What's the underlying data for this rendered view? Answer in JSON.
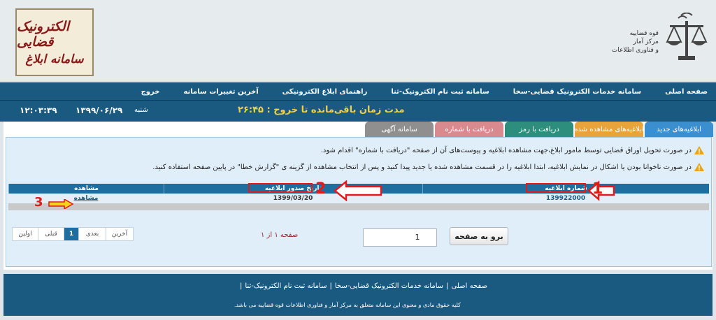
{
  "header": {
    "logo_line1": "الکترونیک قضایی",
    "logo_line2": "سامانه ابلاغ",
    "org_line1": "قوه قضاییه",
    "org_line2": "مرکز آمار",
    "org_line3": "و فناوری اطلاعات"
  },
  "nav": {
    "items": [
      "صفحه اصلی",
      "سامانه خدمات الکترونیک قضایی-سخا",
      "سامانه ثبت نام الکترونیک-ثنا",
      "راهنمای ابلاغ الکترونیکی",
      "آخرین تغییرات سامانه",
      "خروج"
    ]
  },
  "status": {
    "day": "شنبه",
    "date": "۱۳۹۹/۰۶/۲۹",
    "time": "۱۲:۰۳:۳۹",
    "remaining": "مدت زمان باقی‌مانده تا خروج : ۲۶:۴۵"
  },
  "tabs": [
    "ابلاغیه‌های جدید",
    "ابلاغیه‌های مشاهده شده",
    "دریافت با رمز",
    "دریافت با شماره",
    "سامانه آگهی"
  ],
  "notices": [
    "در صورت تحویل اوراق قضایی توسط مامور ابلاغ،جهت مشاهده ابلاغیه و پیوست‌های آن از صفحه \"دریافت با شماره\" اقدام شود.",
    "در صورت ناخوانا بودن یا اشکال در نمایش ابلاغیه، ابتدا ابلاغیه را در قسمت مشاهده شده یا جدید پیدا کنید و پس از انتخاب مشاهده از گزینه ی \"گزارش خطا\" در پایین صفحه استفاده کنید."
  ],
  "grid": {
    "columns": [
      "شماره ابلاغیه",
      "تاریخ صدور ابلاغیه",
      "مشاهده"
    ],
    "rows": [
      {
        "number": "139922000",
        "date": "1399/03/20",
        "view": "مشاهده"
      }
    ]
  },
  "pager": {
    "first": "اولین",
    "prev": "قبلی",
    "current": "1",
    "next": "بعدی",
    "last": "آخرین",
    "page_info": "صفحه ۱ از ۱",
    "input_value": "1",
    "go_label": "برو به صفحه"
  },
  "annotations": [
    "1",
    "2",
    "3"
  ],
  "footer": {
    "links": [
      "صفحه اصلی",
      "سامانه خدمات الکترونیک قضایی-سخا",
      "سامانه ثبت نام الکترونیک-ثنا"
    ],
    "copyright": "کلیه حقوق مادی و معنوی این سامانه متعلق به مرکز آمار و فناوری اطلاعات قوه قضاییه می باشد."
  },
  "colors": {
    "nav_bg": "#1a5a80",
    "accent_red": "#e11b1b",
    "timer_yellow": "#f1d04a"
  }
}
